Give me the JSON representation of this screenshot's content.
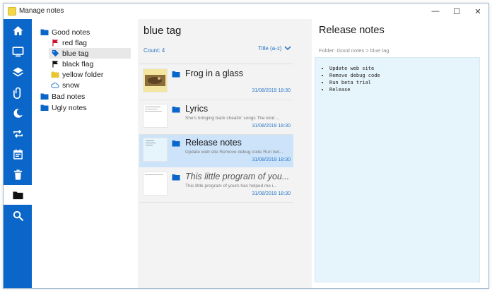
{
  "window": {
    "title": "Manage notes",
    "controls": {
      "minimize": "—",
      "maximize": "☐",
      "close": "✕"
    }
  },
  "sidebar": {
    "items": [
      {
        "name": "home-icon"
      },
      {
        "name": "monitor-icon"
      },
      {
        "name": "layers-icon"
      },
      {
        "name": "paperclip-icon"
      },
      {
        "name": "moon-icon"
      },
      {
        "name": "repeat-icon"
      },
      {
        "name": "calendar-icon"
      },
      {
        "name": "trash-icon"
      },
      {
        "name": "folder-icon",
        "active": true
      },
      {
        "name": "search-icon"
      }
    ]
  },
  "folders": {
    "items": [
      {
        "label": "Good notes",
        "icon": "folder-icon",
        "color": "#0a66c8"
      },
      {
        "label": "red flag",
        "icon": "flag-icon",
        "color": "#c8102e"
      },
      {
        "label": "blue tag",
        "icon": "tag-icon",
        "color": "#0a66c8",
        "selected": true
      },
      {
        "label": "black flag",
        "icon": "flag-icon",
        "color": "#111111"
      },
      {
        "label": "yellow folder",
        "icon": "folder-icon",
        "color": "#e8c531"
      },
      {
        "label": "snow",
        "icon": "snowflake-icon",
        "color": "#2a78c8"
      },
      {
        "label": "Bad notes",
        "icon": "folder-icon",
        "color": "#0a66c8"
      },
      {
        "label": "Ugly notes",
        "icon": "folder-icon",
        "color": "#0a66c8"
      }
    ]
  },
  "list": {
    "title": "blue tag",
    "count": "Count: 4",
    "sort": "Title (a-z)",
    "notes": [
      {
        "title": "Frog in a glass",
        "snippet": "",
        "date": "31/08/2019 18:30"
      },
      {
        "title": "Lyrics",
        "snippet": "She's bringing back cheatin' songs The kind ...",
        "date": "31/08/2019 18:30"
      },
      {
        "title": "Release notes",
        "snippet": "Update web site Remove debug code Run bet...",
        "date": "31/08/2019 18:30",
        "selected": true
      },
      {
        "title": "This little program of you...",
        "snippet": "This little program of yours has helped me i...",
        "date": "31/08/2019 18:30"
      }
    ]
  },
  "detail": {
    "title": "Release notes",
    "breadcrumb": "Folder: Good notes > blue tag",
    "items": [
      "Update web site",
      "Remove debug code",
      "Run beta trial",
      "Release"
    ]
  },
  "colors": {
    "accent": "#0a66c8",
    "link": "#2a78c8",
    "selection": "#cde3f9",
    "content_bg": "#e6f4fb"
  }
}
